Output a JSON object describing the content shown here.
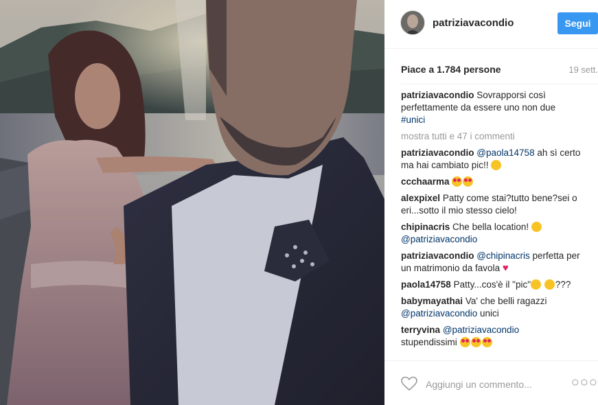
{
  "post": {
    "username": "patriziavacondio",
    "follow_label": "Segui",
    "likes": "Piace a 1.784 persone",
    "date": "19 sett.",
    "caption_user": "patriziavacondio",
    "caption_text": "Sovrapporsi così perfettamente da essere uno non due",
    "caption_tag": "#unici",
    "more_comments": "mostra tutti e 47 i commenti",
    "add_comment_placeholder": "Aggiungi un commento...",
    "options_glyph": "○○○"
  },
  "comments": [
    {
      "user": "patriziavacondio",
      "mention": "@paola14758",
      "text": " ah sì certo ma hai cambiato pic!!",
      "emoji": [
        "tongue-face-icon"
      ]
    },
    {
      "user": "ccchaarma",
      "mention": "",
      "text": "",
      "emoji": [
        "heart-eyes-icon",
        "heart-eyes-icon"
      ]
    },
    {
      "user": "alexpixel",
      "mention": "",
      "text": "Patty come stai?tutto bene?sei o eri...sotto il mio stesso cielo!",
      "emoji": []
    },
    {
      "user": "chipinacris",
      "mention": "",
      "text": "Che bella location!",
      "emoji": [
        "tongue-face-icon"
      ],
      "mention_after": "@patriziavacondio"
    },
    {
      "user": "patriziavacondio",
      "mention": "@chipinacris",
      "text": " perfetta per un matrimonio da favola",
      "emoji": [
        "red-heart-icon"
      ]
    },
    {
      "user": "paola14758",
      "mention": "",
      "text": "Patty...cos'è il \"pic\"",
      "emoji": [
        "sad-face-icon",
        "worried-face-icon"
      ],
      "text_after": "???"
    },
    {
      "user": "babymayathai",
      "mention": "",
      "text": "Va' che belli ragazzi",
      "emoji": [],
      "mention_after": "@patriziavacondio",
      "text_after": " unici"
    },
    {
      "user": "terryvina",
      "mention": "@patriziavacondio",
      "text": " stupendissimi",
      "emoji": [
        "heart-eyes-icon",
        "heart-eyes-icon",
        "heart-eyes-icon"
      ]
    }
  ]
}
